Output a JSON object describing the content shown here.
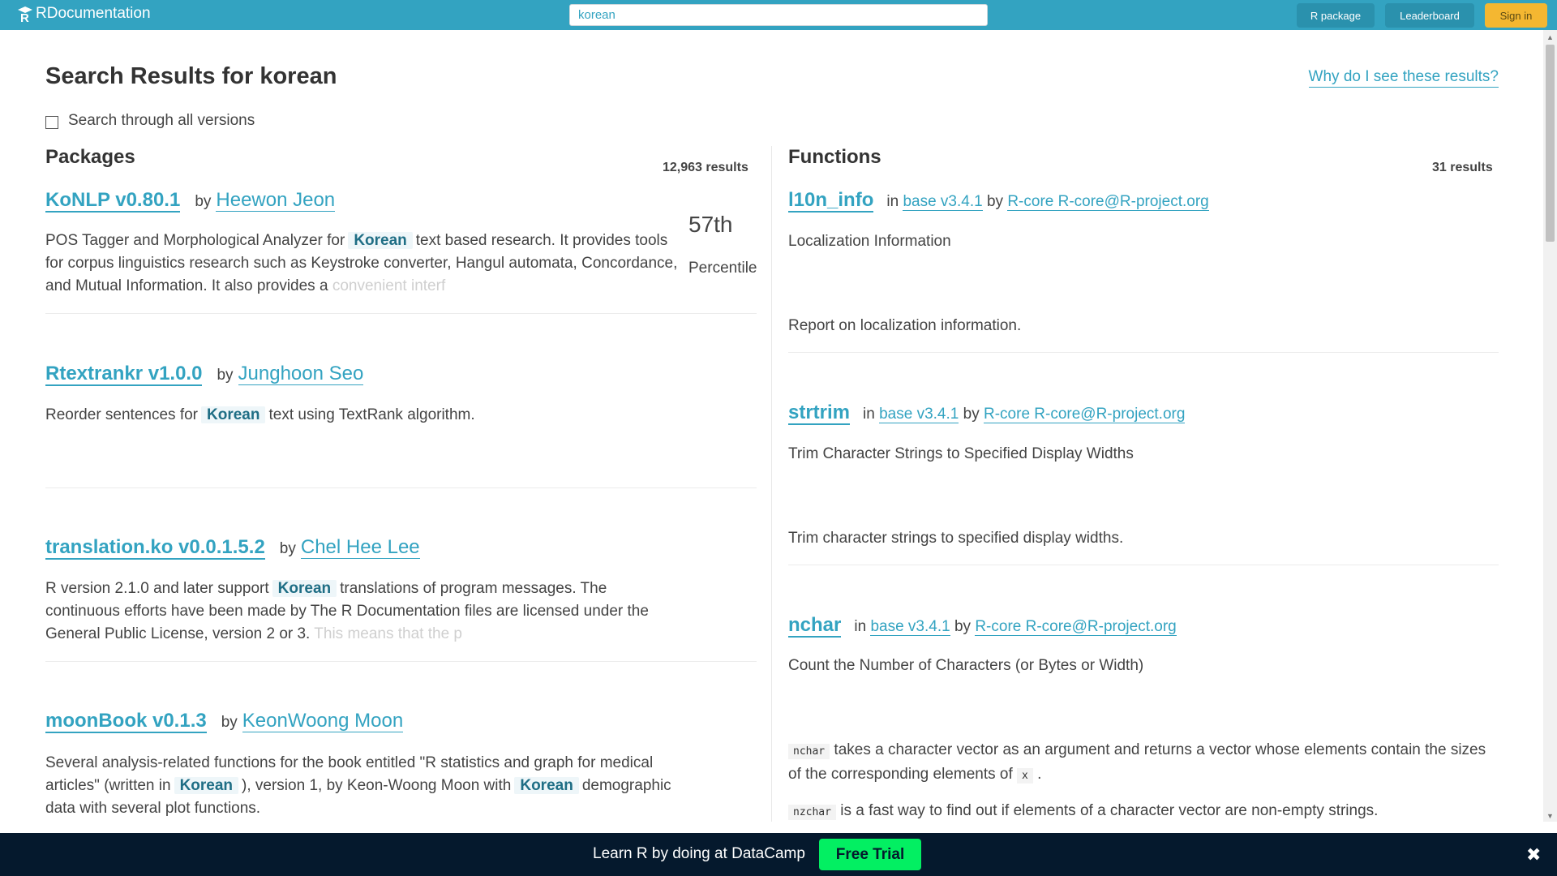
{
  "header": {
    "logo_text": "RDocumentation",
    "search_value": "korean",
    "nav": {
      "r_package": "R package",
      "leaderboard": "Leaderboard",
      "sign_in": "Sign in"
    }
  },
  "page": {
    "title": "Search Results for korean",
    "why_link": "Why do I see these results?",
    "all_versions_label": "Search through all versions"
  },
  "packages": {
    "heading": "Packages",
    "count": "12,963 results",
    "by_label": "by",
    "percentile": {
      "value": "57th",
      "label": "Percentile"
    },
    "items": [
      {
        "name": "KoNLP v0.80.1",
        "author": "Heewon Jeon",
        "desc_1": "POS Tagger and Morphological Analyzer for",
        "hl_1": "Korean",
        "desc_2": "text based research. It provides tools for corpus linguistics research such as Keystroke converter, Hangul automata, Concordance, and Mutual Information. It also provides a",
        "desc_fade": "convenient interf"
      },
      {
        "name": "Rtextrankr v1.0.0",
        "author": "Junghoon Seo",
        "desc_1": "Reorder sentences for",
        "hl_1": "Korean",
        "desc_2": "text using TextRank algorithm."
      },
      {
        "name": "translation.ko v0.0.1.5.2",
        "author": "Chel Hee Lee",
        "desc_1": "R version 2.1.0 and later support",
        "hl_1": "Korean",
        "desc_2": "translations of program messages. The continuous efforts have been made by The R Documentation files are licensed under the General Public License, version 2 or 3.",
        "desc_fade": "This means that the p"
      },
      {
        "name": "moonBook v0.1.3",
        "author": "KeonWoong Moon",
        "desc_1": "Several analysis-related functions for the book entitled \"R statistics and graph for medical articles\" (written in",
        "hl_1": "Korean",
        "desc_2": "), version 1, by Keon-Woong Moon with",
        "hl_2": "Korean",
        "desc_3": "demographic data with several plot functions."
      }
    ]
  },
  "functions": {
    "heading": "Functions",
    "count": "31 results",
    "in_label": "in",
    "by_label": "by",
    "items": [
      {
        "name": "l10n_info",
        "package": "base v3.4.1",
        "author": "R-core R-core@R-project.org",
        "title": "Localization Information",
        "desc": "Report on localization information."
      },
      {
        "name": "strtrim",
        "package": "base v3.4.1",
        "author": "R-core R-core@R-project.org",
        "title": "Trim Character Strings to Specified Display Widths",
        "desc": "Trim character strings to specified display widths."
      },
      {
        "name": "nchar",
        "package": "base v3.4.1",
        "author": "R-core R-core@R-project.org",
        "title": "Count the Number of Characters (or Bytes or Width)",
        "code_1": "nchar",
        "desc_1": "takes a character vector as an argument and returns a vector whose elements contain the sizes of the corresponding elements of",
        "code_2": "x",
        "desc_1_end": ".",
        "code_3": "nzchar",
        "desc_2": "is a fast way to find out if elements of a character vector are non-empty strings."
      }
    ]
  },
  "banner": {
    "text": "Learn R by doing at DataCamp",
    "button": "Free Trial",
    "close": "✖"
  }
}
